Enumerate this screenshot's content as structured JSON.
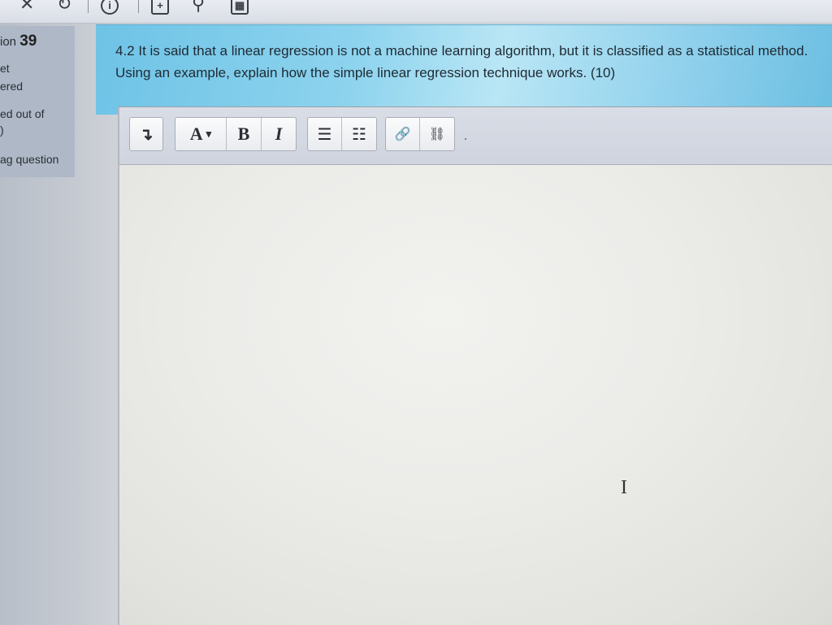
{
  "sidebar": {
    "question_label": "ion",
    "question_number": "39",
    "status_line1": "et",
    "status_line2": "ered",
    "marked_label": "ed out of",
    "marked_value": ")",
    "flag_label": "ag question"
  },
  "question": {
    "text": "4.2 It is said that a linear regression is not a machine learning algorithm, but it is classified as a statistical method. Using an example, explain how the simple linear regression technique works. (10)"
  },
  "editor": {
    "toolbar": {
      "expand_glyph": "↴",
      "font_color_label": "A",
      "dropdown_glyph": "▾",
      "bold_label": "B",
      "italic_label": "I",
      "unordered_list_glyph": "☰",
      "ordered_list_glyph": "☷",
      "link_glyph": "🔗",
      "unlink_glyph": "⛓"
    },
    "content": ""
  },
  "icons": [
    "back-icon",
    "refresh-icon",
    "info-icon",
    "add-icon",
    "search-icon",
    "calendar-icon",
    "text-cursor-icon"
  ]
}
